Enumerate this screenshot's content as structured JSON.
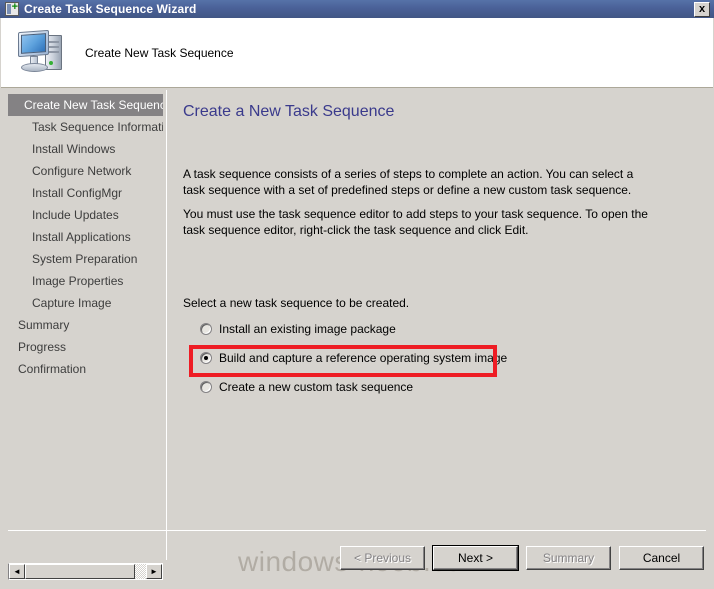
{
  "window": {
    "title": "Create Task Sequence Wizard",
    "title_icon": "task-sequence-wizard-icon",
    "close_label": "x"
  },
  "banner": {
    "icon": "computer-monitor-icon",
    "title": "Create New Task Sequence"
  },
  "sidebar": {
    "items": [
      {
        "label": "Create New Task Sequence",
        "level": "top",
        "selected": true
      },
      {
        "label": "Task Sequence Informatio",
        "level": "sub",
        "selected": false
      },
      {
        "label": "Install Windows",
        "level": "sub",
        "selected": false
      },
      {
        "label": "Configure Network",
        "level": "sub",
        "selected": false
      },
      {
        "label": "Install ConfigMgr",
        "level": "sub",
        "selected": false
      },
      {
        "label": "Include Updates",
        "level": "sub",
        "selected": false
      },
      {
        "label": "Install Applications",
        "level": "sub",
        "selected": false
      },
      {
        "label": "System Preparation",
        "level": "sub",
        "selected": false
      },
      {
        "label": "Image Properties",
        "level": "sub",
        "selected": false
      },
      {
        "label": "Capture Image",
        "level": "sub",
        "selected": false
      },
      {
        "label": "Summary",
        "level": "top",
        "selected": false
      },
      {
        "label": "Progress",
        "level": "top",
        "selected": false
      },
      {
        "label": "Confirmation",
        "level": "top",
        "selected": false
      }
    ],
    "scrollbar": {
      "left_arrow": "◄",
      "right_arrow": "►"
    }
  },
  "main": {
    "page_title": "Create a New Task Sequence",
    "paragraph1": "A task sequence consists of a series of steps to complete an action. You can select a task sequence with a set of predefined steps or define a new custom task sequence.",
    "paragraph2": "You must use the task sequence editor to add steps to your task sequence. To open the task sequence editor, right-click the task sequence and click Edit.",
    "select_label": "Select a new task sequence to be created.",
    "options": [
      {
        "label": "Install an existing image package",
        "selected": false
      },
      {
        "label": "Build and capture a reference operating system image",
        "selected": true
      },
      {
        "label": "Create a new custom task sequence",
        "selected": false
      }
    ]
  },
  "annotation": {
    "highlight_color": "#ee1c24",
    "highlights": "build-and-capture-option"
  },
  "footer": {
    "buttons": [
      {
        "label": "< Previous",
        "state": "disabled"
      },
      {
        "label": "Next >",
        "state": "default"
      },
      {
        "label": "Summary",
        "state": "disabled"
      },
      {
        "label": "Cancel",
        "state": "enabled"
      }
    ]
  },
  "watermark": {
    "text": "windows-noob.com"
  }
}
